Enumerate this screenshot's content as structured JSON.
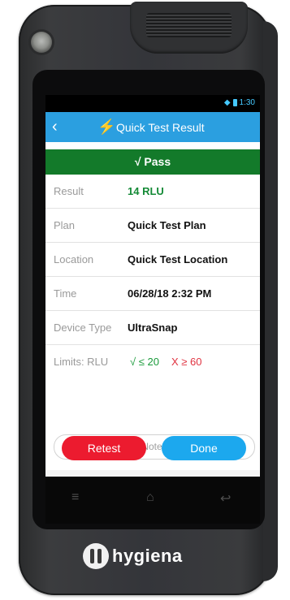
{
  "device": {
    "brand": "hygiena"
  },
  "status_bar": {
    "time": "1:30"
  },
  "app_bar": {
    "title": "Quick Test Result"
  },
  "result_banner": {
    "text": "√ Pass"
  },
  "rows": [
    {
      "label": "Result",
      "value": "14 RLU"
    },
    {
      "label": "Plan",
      "value": "Quick Test Plan"
    },
    {
      "label": "Location",
      "value": "Quick Test Location"
    },
    {
      "label": "Time",
      "value": "06/28/18 2:32 PM"
    },
    {
      "label": "Device Type",
      "value": "UltraSnap"
    }
  ],
  "limits": {
    "label": "Limits: RLU",
    "pass": "√ ≤ 20",
    "fail": "X ≥ 60"
  },
  "notes": {
    "placeholder": "Notes"
  },
  "buttons": {
    "retest": "Retest",
    "done": "Done"
  },
  "colors": {
    "app_bar": "#2b9fe0",
    "pass_banner": "#137a2a",
    "retest_button": "#ec1b2f",
    "done_button": "#1ca8ee"
  }
}
